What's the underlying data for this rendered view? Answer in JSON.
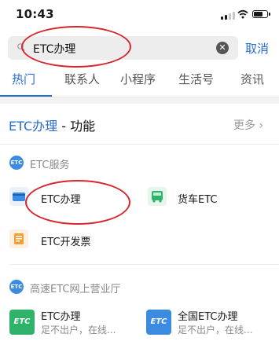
{
  "status_bar": {
    "time": "10:43"
  },
  "search": {
    "query": "ETC办理",
    "cancel_label": "取消"
  },
  "tabs": [
    {
      "label": "热门",
      "active": true
    },
    {
      "label": "联系人",
      "active": false
    },
    {
      "label": "小程序",
      "active": false
    },
    {
      "label": "生活号",
      "active": false
    },
    {
      "label": "资讯",
      "active": false
    }
  ],
  "function_section": {
    "title_highlight": "ETC办理",
    "title_suffix": " - 功能",
    "more_label": "更多 ›"
  },
  "etc_service": {
    "icon_text": "ETC",
    "label": "ETC服务",
    "items": [
      {
        "label": "ETC办理",
        "icon": "card-icon"
      },
      {
        "label": "货车ETC",
        "icon": "truck-icon"
      },
      {
        "label": "ETC开发票",
        "icon": "invoice-icon"
      }
    ]
  },
  "highway_hall": {
    "icon_text": "ETC",
    "label": "高速ETC网上营业厅",
    "cards": [
      {
        "logo": "ETC",
        "title": "ETC办理",
        "subtitle": "足不出户，在线..."
      },
      {
        "logo": "ETC",
        "title": "全国ETC办理",
        "subtitle": "足不出户，在线..."
      }
    ]
  },
  "colors": {
    "accent": "#2a6ccf",
    "annotation": "#d8262e",
    "etc_green": "#2fb36a",
    "etc_blue": "#3b8be0"
  }
}
